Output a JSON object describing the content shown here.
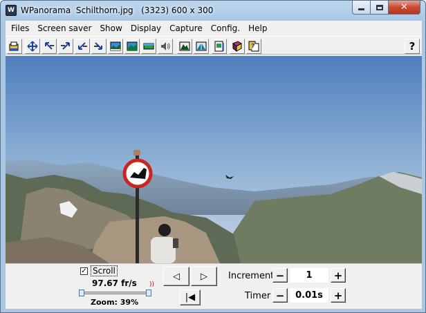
{
  "window": {
    "title": "WPanorama  Schilthorn.jpg   (3323) 600 x 300",
    "app_icon": "wpanorama-app-icon",
    "close_glyph": "✕"
  },
  "menu": {
    "items": [
      "Files",
      "Screen saver",
      "Show",
      "Display",
      "Capture",
      "Config.",
      "Help"
    ]
  },
  "toolbar": {
    "buttons": [
      "open-file-icon",
      "center-icon",
      "scroll-left-up-icon",
      "scroll-right-up-icon",
      "scroll-left-down-icon",
      "scroll-right-down-icon",
      "panorama-view-icon",
      "panorama-view-2-icon",
      "panorama-strip-icon",
      "sound-icon",
      "mountain-icon",
      "mountain-peak-icon",
      "document-icon",
      "book-icon",
      "info-icon"
    ],
    "help_label": "?"
  },
  "controls": {
    "scroll_checked": true,
    "check_glyph": "✓",
    "scroll_label": "Scroll",
    "fps": "97.67 fr/s",
    "speaker_glyph": "))",
    "zoom_label": "Zoom: 39%",
    "zoom_fraction": 0.39,
    "prev_glyph": "◁",
    "next_glyph": "▷",
    "first_glyph": "|◀",
    "increment_label": "Increment",
    "increment_value": "1",
    "timer_label": "Timer",
    "timer_value": "0.01s",
    "minus": "−",
    "plus": "+"
  },
  "colors": {
    "sky_top": "#4f7fbd",
    "sky_bottom": "#b9cde1",
    "sign_red": "#c8261e"
  }
}
